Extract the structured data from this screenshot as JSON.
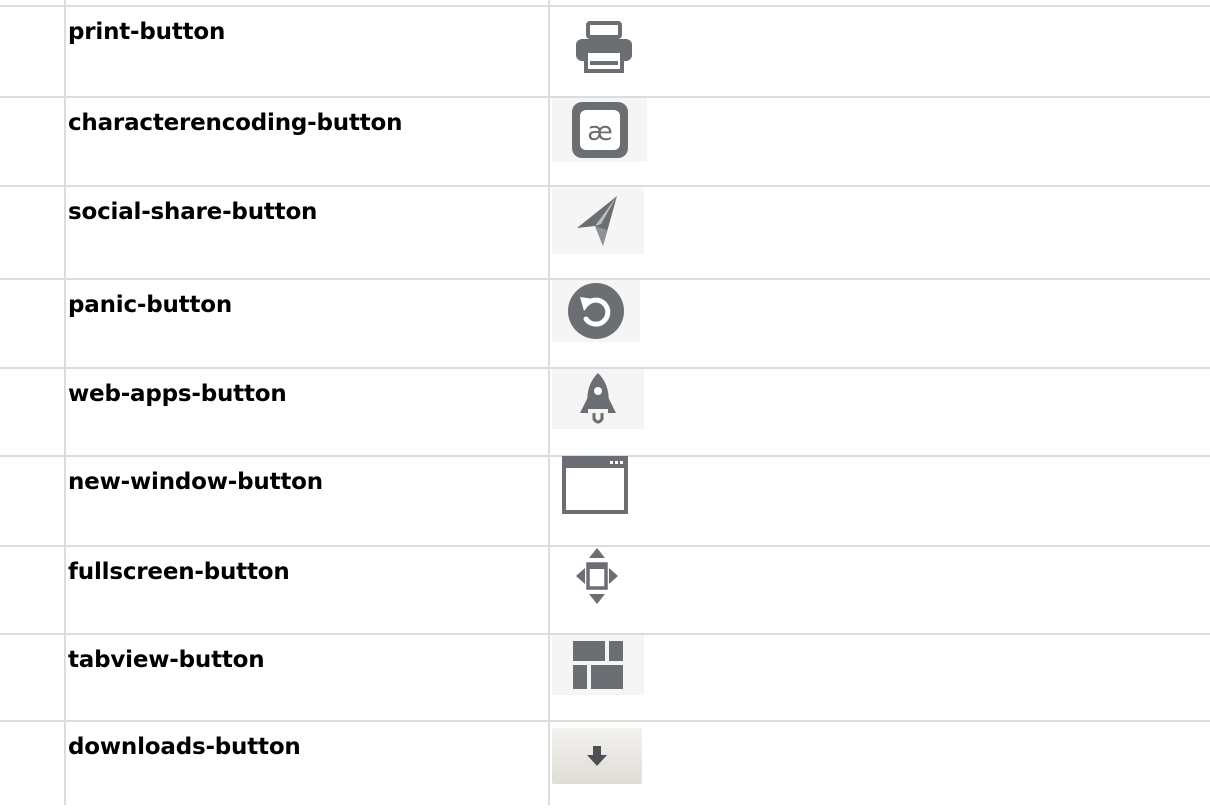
{
  "rows": [
    {
      "label": "print-button",
      "icon": "printer-icon"
    },
    {
      "label": "characterencoding-button",
      "icon": "character-encoding-icon",
      "glyph": "æ"
    },
    {
      "label": "social-share-button",
      "icon": "paper-plane-icon"
    },
    {
      "label": "panic-button",
      "icon": "undo-circle-icon"
    },
    {
      "label": "web-apps-button",
      "icon": "rocket-icon"
    },
    {
      "label": "new-window-button",
      "icon": "window-icon"
    },
    {
      "label": "fullscreen-button",
      "icon": "fullscreen-arrows-icon"
    },
    {
      "label": "tabview-button",
      "icon": "tabview-grid-icon"
    },
    {
      "label": "downloads-button",
      "icon": "download-arrow-icon"
    }
  ],
  "colors": {
    "icon": "#6b6e72",
    "grid": "#dcdcdc",
    "icon_bg": "#f5f5f5"
  }
}
